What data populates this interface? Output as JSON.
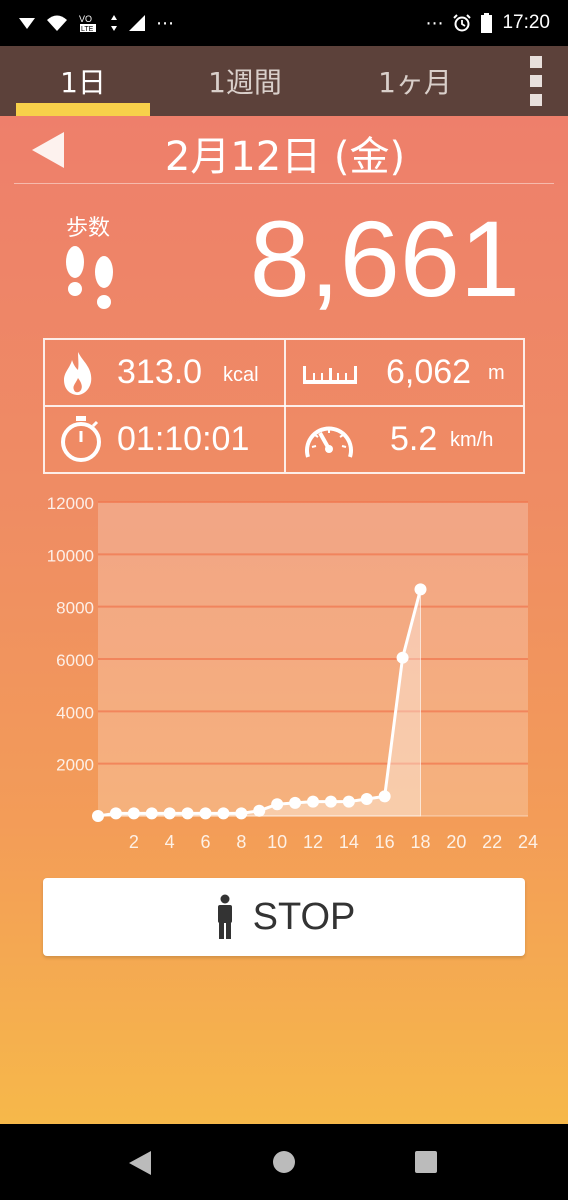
{
  "status_bar": {
    "time": "17:20",
    "icons_left": [
      "signal-icon",
      "wifi-icon",
      "volte-icon",
      "data-arrows-icon",
      "cell-signal-icon",
      "more-notifications-icon"
    ],
    "icons_right": [
      "more-icon",
      "alarm-icon",
      "battery-icon"
    ]
  },
  "tabs": [
    {
      "label": "1日",
      "active": true
    },
    {
      "label": "1週間",
      "active": false
    },
    {
      "label": "1ヶ月",
      "active": false
    }
  ],
  "date": {
    "label": "2月12日 (金)"
  },
  "steps": {
    "label": "歩数",
    "value": "8,661"
  },
  "stats": {
    "calories": {
      "value": "313.0",
      "unit": "kcal",
      "icon": "flame-icon"
    },
    "distance": {
      "value": "6,062",
      "unit": "m",
      "icon": "ruler-icon"
    },
    "time": {
      "value": "01:10:01",
      "icon": "stopwatch-icon"
    },
    "speed": {
      "value": "5.2",
      "unit": "km/h",
      "icon": "speedometer-icon"
    }
  },
  "chart_data": {
    "type": "line",
    "x": [
      0,
      1,
      2,
      3,
      4,
      5,
      6,
      7,
      8,
      9,
      10,
      11,
      12,
      13,
      14,
      15,
      16,
      17,
      18
    ],
    "y": [
      0,
      100,
      100,
      100,
      100,
      100,
      100,
      100,
      100,
      200,
      450,
      500,
      550,
      550,
      550,
      650,
      750,
      6050,
      8661
    ],
    "xlim": [
      0,
      24
    ],
    "ylim": [
      0,
      12000
    ],
    "xticks": [
      "2",
      "4",
      "6",
      "8",
      "10",
      "12",
      "14",
      "16",
      "18",
      "20",
      "22",
      "24"
    ],
    "yticks": [
      "2000",
      "4000",
      "6000",
      "8000",
      "10000",
      "12000"
    ],
    "grid": true,
    "filled_area": true
  },
  "stop_button": {
    "label": "STOP",
    "icon": "person-icon"
  },
  "nav": {
    "icons": [
      "back-icon",
      "home-icon",
      "recents-icon"
    ]
  }
}
